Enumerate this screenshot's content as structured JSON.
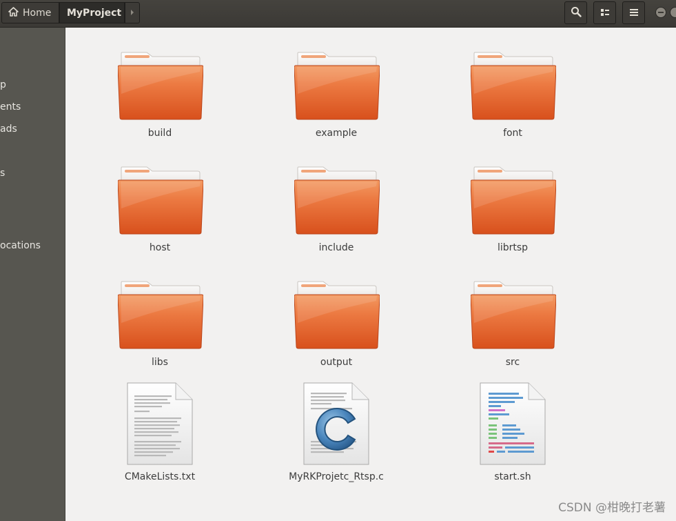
{
  "header": {
    "home_label": "Home",
    "current_folder": "MyProject"
  },
  "sidebar": {
    "items": [
      {
        "label": "p"
      },
      {
        "label": "ents"
      },
      {
        "label": "ads"
      },
      {
        "label": "s"
      },
      {
        "label": "ocations"
      }
    ]
  },
  "files": [
    {
      "name": "build",
      "type": "folder"
    },
    {
      "name": "example",
      "type": "folder"
    },
    {
      "name": "font",
      "type": "folder"
    },
    {
      "name": "host",
      "type": "folder"
    },
    {
      "name": "include",
      "type": "folder"
    },
    {
      "name": "librtsp",
      "type": "folder"
    },
    {
      "name": "libs",
      "type": "folder"
    },
    {
      "name": "output",
      "type": "folder"
    },
    {
      "name": "src",
      "type": "folder"
    },
    {
      "name": "CMakeLists.txt",
      "type": "text-file"
    },
    {
      "name": "MyRKProjetc_Rtsp.c",
      "type": "c-source-file"
    },
    {
      "name": "start.sh",
      "type": "shell-script"
    }
  ],
  "watermark": "CSDN @柑晚打老薯",
  "colors": {
    "folder_body": "#e2622a",
    "folder_tab": "#f0a57a",
    "header_bg": "#3b3935",
    "sidebar_bg": "#575650",
    "main_bg": "#f2f1f0"
  }
}
